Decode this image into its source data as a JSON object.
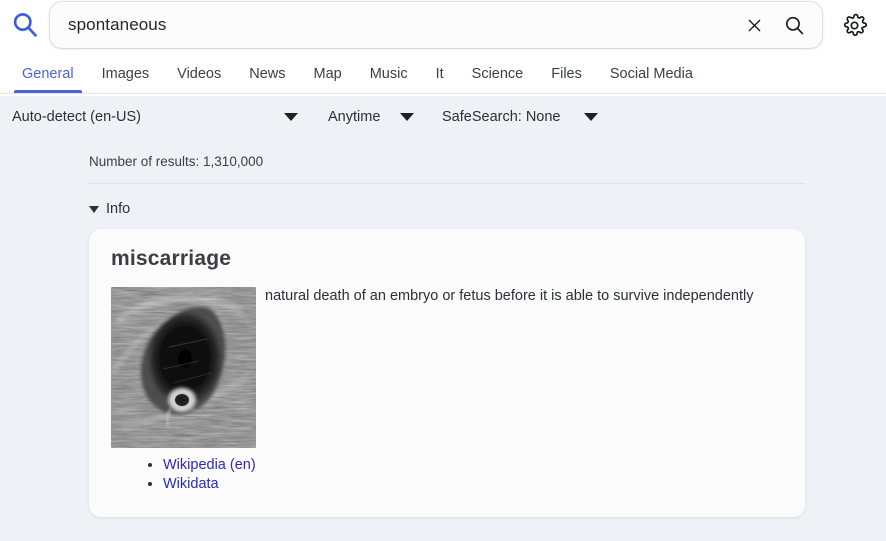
{
  "header": {
    "logo_icon": "magnifier-logo-icon",
    "search": {
      "value": "spontaneous",
      "placeholder": "Search for...",
      "clear_icon": "close-icon",
      "submit_icon": "search-icon"
    },
    "preferences_icon": "gear-icon",
    "accent_color": "#4b63d8"
  },
  "tabs": [
    {
      "label": "General",
      "active": true
    },
    {
      "label": "Images",
      "active": false
    },
    {
      "label": "Videos",
      "active": false
    },
    {
      "label": "News",
      "active": false
    },
    {
      "label": "Map",
      "active": false
    },
    {
      "label": "Music",
      "active": false
    },
    {
      "label": "It",
      "active": false
    },
    {
      "label": "Science",
      "active": false
    },
    {
      "label": "Files",
      "active": false
    },
    {
      "label": "Social Media",
      "active": false
    }
  ],
  "filters": {
    "language": "Auto-detect (en-US)",
    "time_range": "Anytime",
    "safesearch": "SafeSearch: None"
  },
  "results": {
    "count_text": "Number of results: 1,310,000",
    "info_section_label": "Info"
  },
  "infobox": {
    "title": "miscarriage",
    "description": "natural death of an embryo or fetus before it is able to survive independently",
    "image_alt": "ultrasound-scan-image",
    "links": [
      {
        "label": "Wikipedia (en)"
      },
      {
        "label": "Wikidata"
      }
    ],
    "link_color": "#2b2bb8"
  }
}
